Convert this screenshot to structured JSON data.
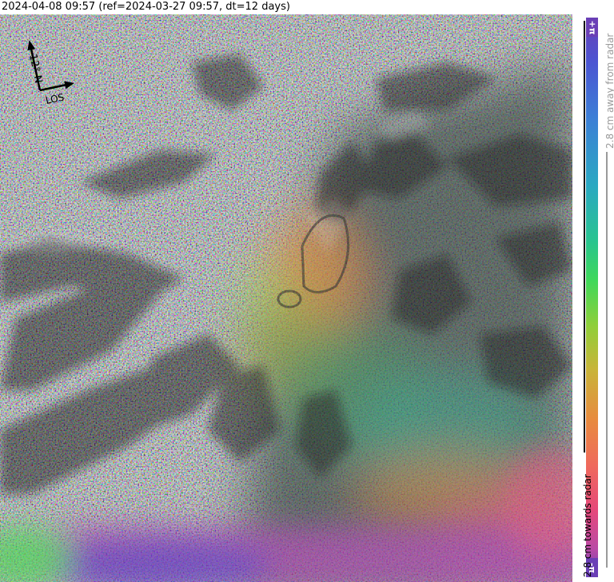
{
  "title": "2024-04-08 09:57 (ref=2024-03-27 09:57, dt=12 days)",
  "compass": {
    "north_label": "N",
    "north_angle_label": "-12°",
    "los_label": "LOS"
  },
  "colorbar": {
    "top_symbol": "+π",
    "bottom_symbol": "-π",
    "away_label": "2.8 cm away from radar",
    "towards_label": "2.8 cm towards radar"
  },
  "colors": {
    "phase_cycle": [
      "#6a3fb6",
      "#3c7fd6",
      "#29c48f",
      "#3fd85a",
      "#c9b43a",
      "#e88a3f",
      "#e6497a",
      "#6a3fb6"
    ],
    "away_line": "#9a9a9a",
    "towards_line": "#000000"
  }
}
